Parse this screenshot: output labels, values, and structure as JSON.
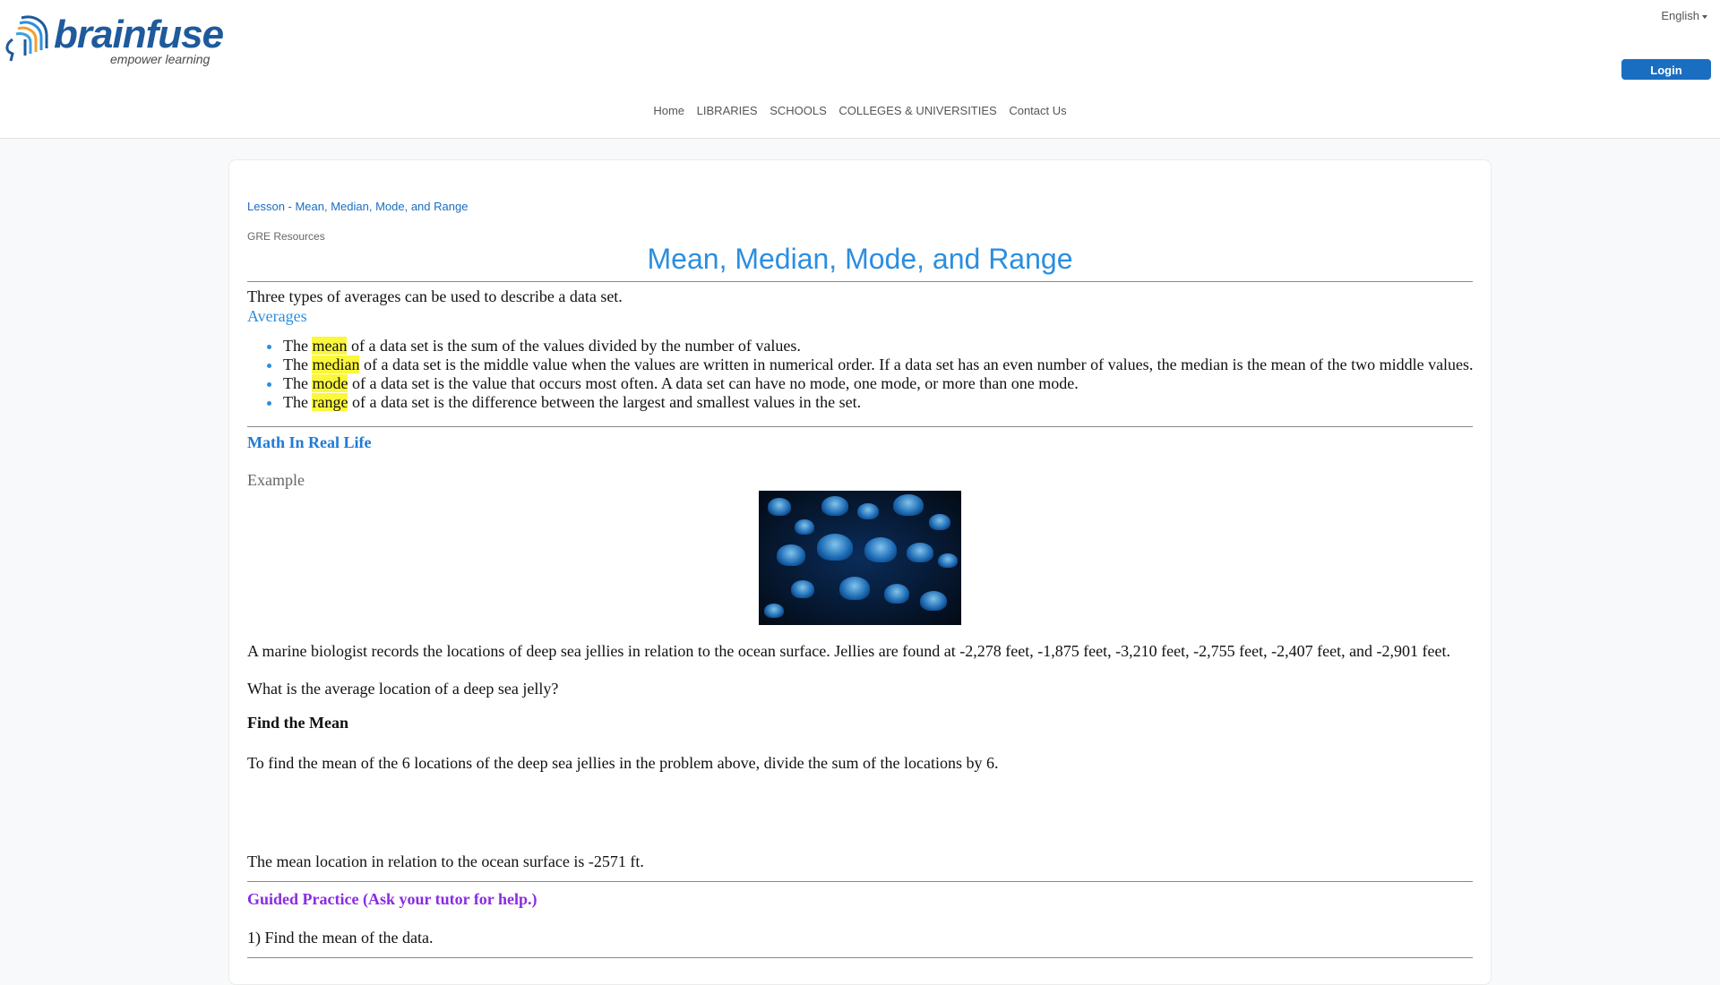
{
  "header": {
    "logo_text": "brainfuse",
    "logo_tagline": "empower learning",
    "language": "English",
    "login_label": "Login",
    "nav": [
      "Home",
      "LIBRARIES",
      "SCHOOLS",
      "COLLEGES & UNIVERSITIES",
      "Contact Us"
    ]
  },
  "lesson": {
    "breadcrumb": "Lesson - Mean, Median, Mode, and Range",
    "category": "GRE Resources",
    "title": "Mean, Median, Mode, and Range",
    "intro": "Three types of averages can be used to describe a data set.",
    "averages_heading": "Averages",
    "definitions": [
      {
        "pre": "The ",
        "term": "mean",
        "post": " of a data set is the sum of the values divided by the number of values."
      },
      {
        "pre": "The ",
        "term": "median",
        "post": " of a data set is the middle value when the values are written in numerical order. If a data set has an even number of values, the median is the mean of the two middle values."
      },
      {
        "pre": "The ",
        "term": "mode",
        "post": " of a data set is the value that occurs most often. A data set can have no mode, one mode, or more than one mode."
      },
      {
        "pre": "The ",
        "term": "range",
        "post": " of a data set is the difference between the largest and smallest values in the set."
      }
    ],
    "real_life_heading": "Math In Real Life",
    "example_label": "Example",
    "problem": "A marine biologist records the locations of deep sea jellies in relation to the ocean surface. Jellies are found at -2,278 feet, -1,875 feet, -3,210 feet, -2,755 feet, -2,407 feet, and -2,901 feet.",
    "question": "What is the average location of a deep sea jelly?",
    "find_mean_heading": "Find the Mean",
    "find_mean_text": "To find the mean of the 6 locations of the deep sea jellies in the problem above, divide the sum of the locations by 6.",
    "answer": "The mean location in relation to the ocean surface is -2571 ft.",
    "guided_heading": "Guided Practice (Ask your tutor for help.)",
    "practice_1": "1) Find the mean of the data."
  },
  "colors": {
    "brand": "#1e5a9c",
    "accent": "#2b8ee0",
    "login": "#1a6ec2",
    "highlight": "#fbf73a",
    "guided": "#8a2be2"
  }
}
